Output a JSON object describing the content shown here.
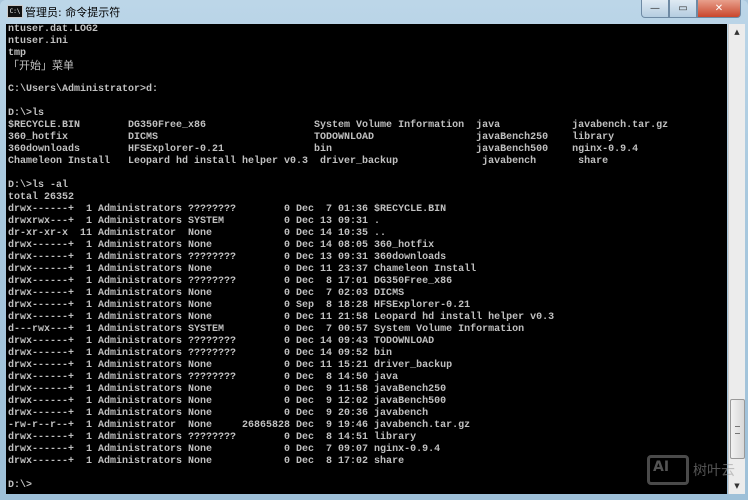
{
  "window": {
    "title": "管理员: 命令提示符",
    "icon_text": "C:\\"
  },
  "controls": {
    "minimize": "—",
    "maximize": "▭",
    "close": "✕"
  },
  "console_lines": [
    "ntuser.dat.LOG2",
    "ntuser.ini",
    "tmp",
    "「开始」菜单",
    "",
    "C:\\Users\\Administrator>d:",
    "",
    "D:\\>ls",
    "$RECYCLE.BIN        DG350Free_x86                  System Volume Information  java            javabench.tar.gz",
    "360_hotfix          DICMS                          TODOWNLOAD                 javaBench250    library",
    "360downloads        HFSExplorer-0.21               bin                        javaBench500    nginx-0.9.4",
    "Chameleon Install   Leopard hd install helper v0.3  driver_backup              javabench       share",
    "",
    "D:\\>ls -al",
    "total 26352",
    "drwx------+  1 Administrators ????????        0 Dec  7 01:36 $RECYCLE.BIN",
    "drwxrwx---+  1 Administrators SYSTEM          0 Dec 13 09:31 .",
    "dr-xr-xr-x  11 Administrator  None            0 Dec 14 10:35 ..",
    "drwx------+  1 Administrators None            0 Dec 14 08:05 360_hotfix",
    "drwx------+  1 Administrators ????????        0 Dec 13 09:31 360downloads",
    "drwx------+  1 Administrators None            0 Dec 11 23:37 Chameleon Install",
    "drwx------+  1 Administrators ????????        0 Dec  8 17:01 DG350Free_x86",
    "drwx------+  1 Administrators None            0 Dec  7 02:03 DICMS",
    "drwx------+  1 Administrators None            0 Sep  8 18:28 HFSExplorer-0.21",
    "drwx------+  1 Administrators None            0 Dec 11 21:58 Leopard hd install helper v0.3",
    "d---rwx---+  1 Administrators SYSTEM          0 Dec  7 00:57 System Volume Information",
    "drwx------+  1 Administrators ????????        0 Dec 14 09:43 TODOWNLOAD",
    "drwx------+  1 Administrators ????????        0 Dec 14 09:52 bin",
    "drwx------+  1 Administrators None            0 Dec 11 15:21 driver_backup",
    "drwx------+  1 Administrators ????????        0 Dec  8 14:50 java",
    "drwx------+  1 Administrators None            0 Dec  9 11:58 javaBench250",
    "drwx------+  1 Administrators None            0 Dec  9 12:02 javaBench500",
    "drwx------+  1 Administrators None            0 Dec  9 20:36 javabench",
    "-rw-r--r--+  1 Administrator  None     26865828 Dec  9 19:46 javabench.tar.gz",
    "drwx------+  1 Administrators ????????        0 Dec  8 14:51 library",
    "drwx------+  1 Administrators None            0 Dec  7 09:07 nginx-0.9.4",
    "drwx------+  1 Administrators None            0 Dec  8 17:02 share",
    "",
    "D:\\>"
  ],
  "scrollbar": {
    "up": "▲",
    "down": "▼",
    "position_fraction": 0.95
  },
  "watermark": {
    "logo_text": "AI",
    "text": "树叶云"
  }
}
